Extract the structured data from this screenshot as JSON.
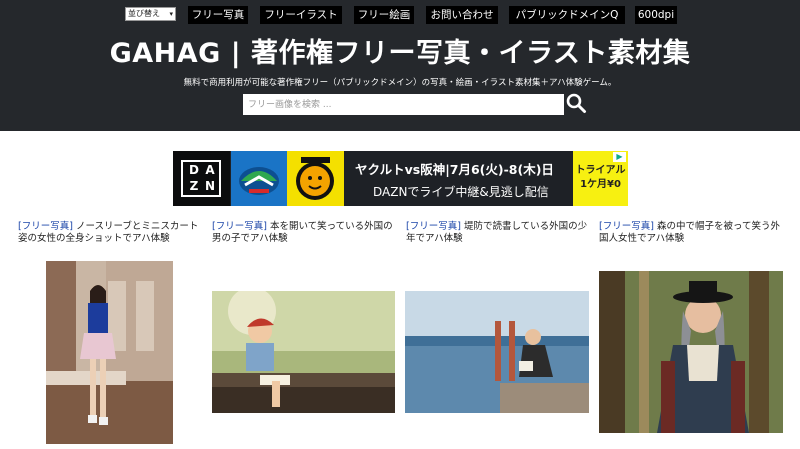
{
  "header": {
    "sort_label": "並び替え",
    "nav": [
      {
        "label": "フリー写真"
      },
      {
        "label": "フリーイラスト"
      },
      {
        "label": "フリー絵画"
      },
      {
        "label": "お問い合わせ"
      },
      {
        "label": "パブリックドメインQ"
      },
      {
        "label": "600dpi"
      }
    ],
    "title": "GAHAG | 著作権フリー写真・イラスト素材集",
    "subtitle": "無料で商用利用が可能な著作権フリー（パブリックドメイン）の写真・絵画・イラスト素材集＋アハ体験ゲーム。",
    "search_placeholder": "フリー画像を検索 ..."
  },
  "ad": {
    "logo_letters": [
      "D",
      "A",
      "Z",
      "N"
    ],
    "headline": "ヤクルトvs阪神|7月6(火)-8(木)日",
    "body": "DAZNでライブ中継&見逃し配信",
    "trial_line1": "トライアル",
    "trial_line2": "1ケ月¥0"
  },
  "posts": [
    {
      "tag": "[フリー写真]",
      "title": " ノースリーブとミニスカート姿の女性の全身ショットでアハ体験"
    },
    {
      "tag": "[フリー写真]",
      "title": " 本を開いて笑っている外国の男の子でアハ体験"
    },
    {
      "tag": "[フリー写真]",
      "title": " 堤防で読書している外国の少年でアハ体験"
    },
    {
      "tag": "[フリー写真]",
      "title": " 森の中で帽子を被って笑う外国人女性でアハ体験"
    }
  ],
  "colors": {
    "header_bg": "#25282c",
    "nav_bg": "#000000",
    "tag_blue": "#1a44a8",
    "ad_yellow": "#f7f011"
  },
  "icons": {
    "search": "magnifier-icon",
    "dropdown": "chevron-down-icon"
  }
}
